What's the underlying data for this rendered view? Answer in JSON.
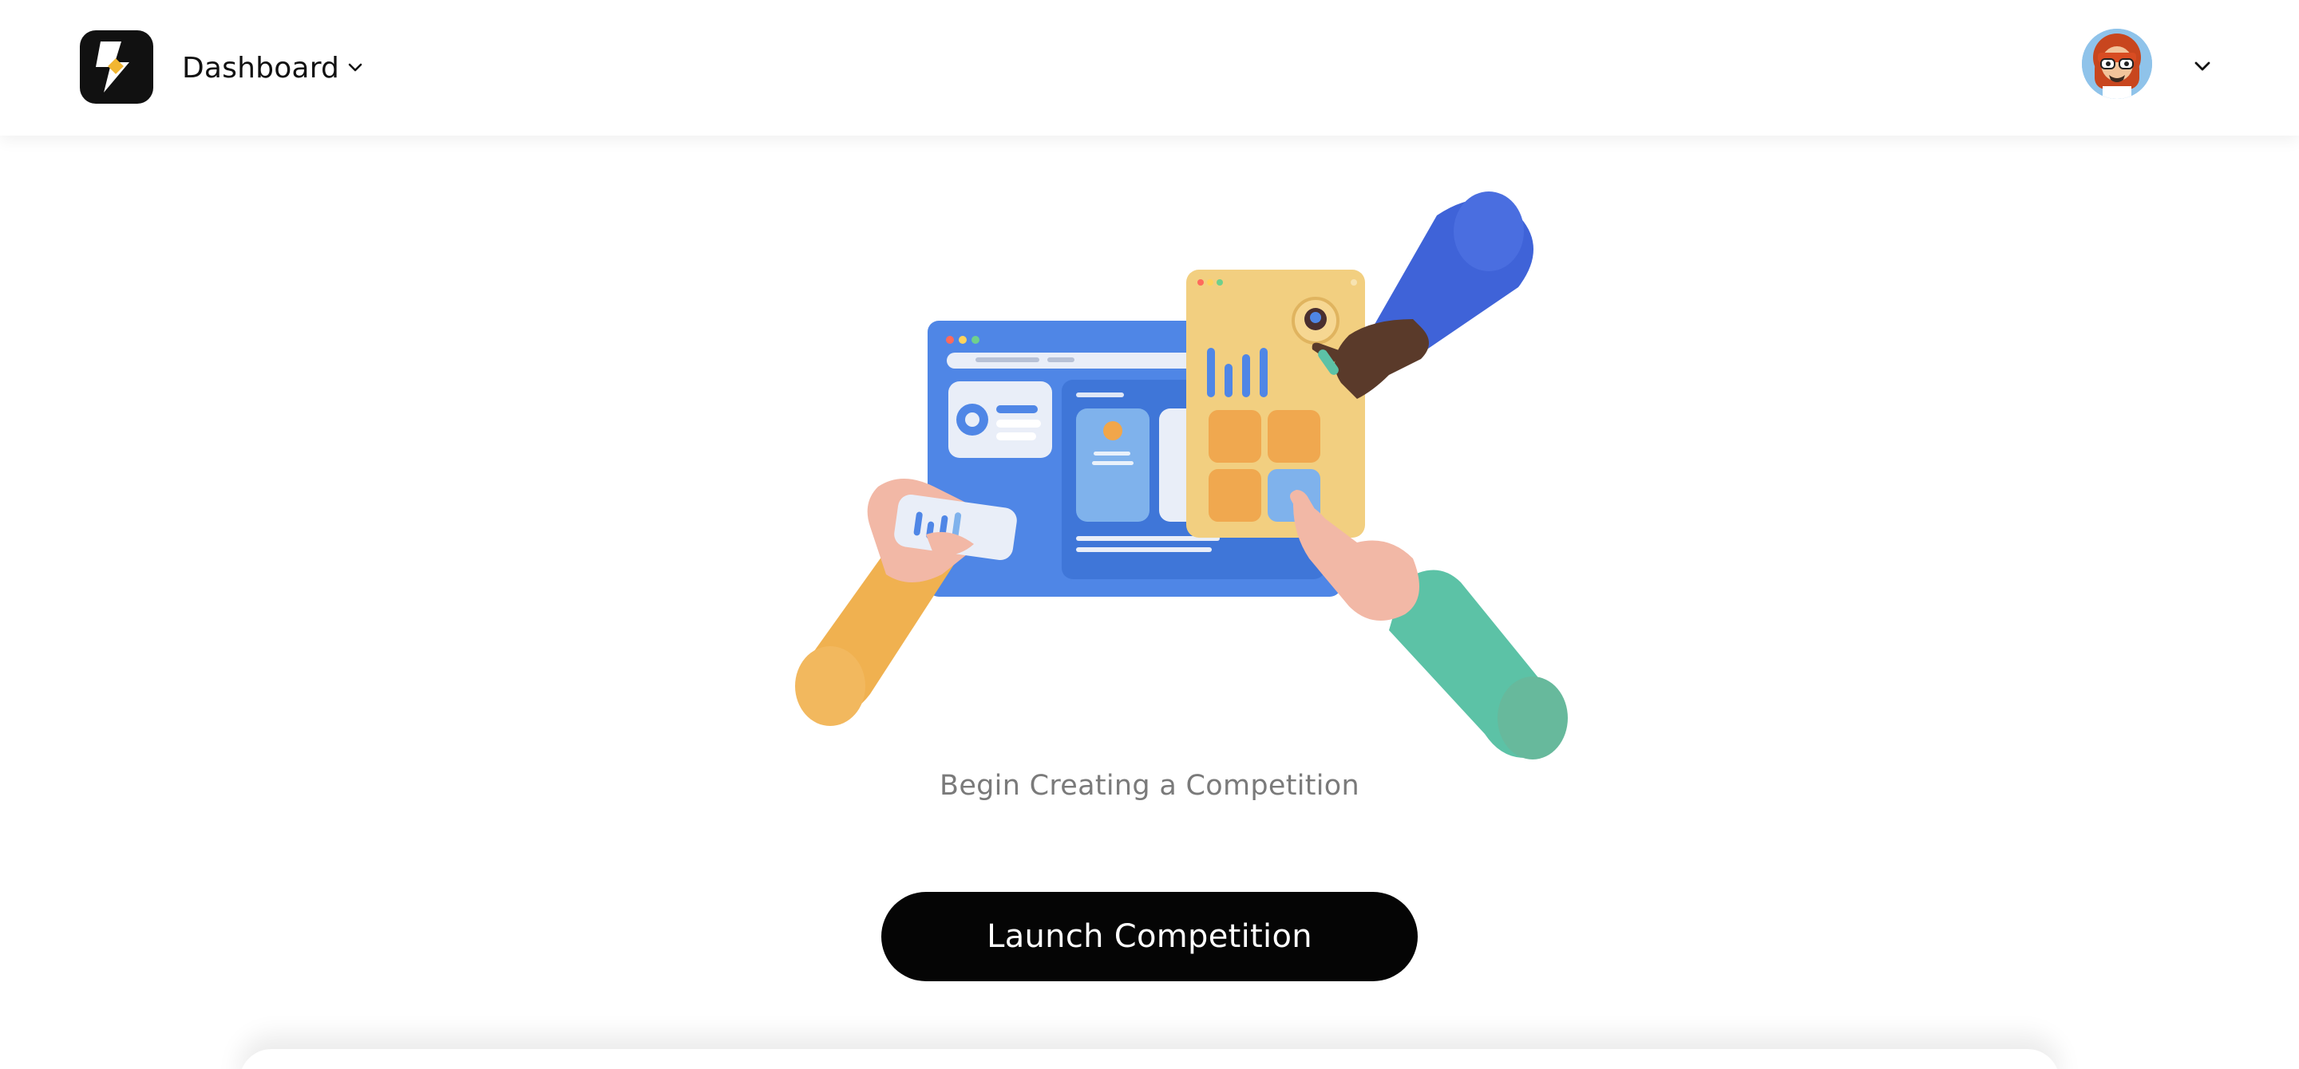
{
  "header": {
    "nav_label": "Dashboard",
    "logo_icon": "bolt-logo-icon",
    "nav_chevron_icon": "chevron-down-icon",
    "avatar_icon": "user-avatar",
    "account_chevron_icon": "chevron-down-icon"
  },
  "main": {
    "illustration": "hands-dashboard-illustration",
    "empty_message": "Begin Creating a Competition",
    "launch_button_label": "Launch Competition"
  },
  "colors": {
    "primary_button": "#050505",
    "text_muted": "#7a7a7a",
    "illustration_blue": "#4f86e6",
    "illustration_yellow": "#f2cf80",
    "illustration_green": "#5cc2a6"
  }
}
